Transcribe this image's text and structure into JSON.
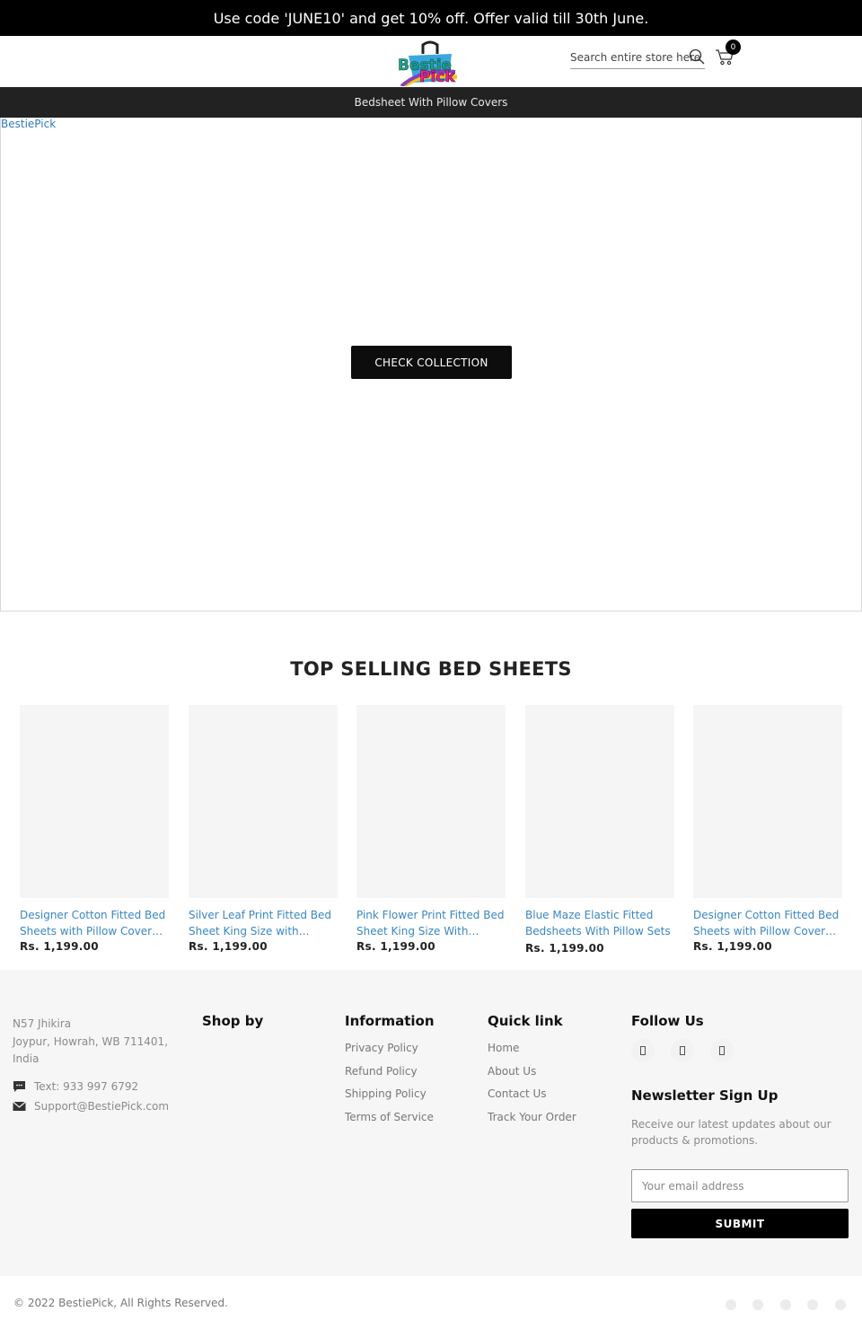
{
  "announcement": {
    "text": "Use code 'JUNE10' and get 10% off. Offer valid till 30th June."
  },
  "header": {
    "logo_alt": "BestiePick",
    "logo_text_top": "Bestie",
    "logo_text_bottom": "Pick",
    "search": {
      "placeholder": "Search entire store here",
      "value": ""
    },
    "cart_count": "0"
  },
  "nav": {
    "items": [
      {
        "label": "Bedsheet With Pillow Covers"
      }
    ]
  },
  "hero": {
    "image_alt": "BestiePick",
    "button_label": "CHECK COLLECTION"
  },
  "products_section": {
    "title": "TOP SELLING BED SHEETS",
    "items": [
      {
        "title": "Designer Cotton Fitted Bed Sheets with Pillow Cover…",
        "price": "Rs. 1,199.00"
      },
      {
        "title": "Silver Leaf Print Fitted Bed Sheet King Size with Pillow…",
        "price": "Rs. 1,199.00"
      },
      {
        "title": "Pink Flower Print Fitted Bed Sheet King Size With Pillow…",
        "price": "Rs. 1,199.00"
      },
      {
        "title": "Blue Maze Elastic Fitted Bedsheets With Pillow Sets",
        "price": "Rs. 1,199.00"
      },
      {
        "title": "Designer Cotton Fitted Bed Sheets with Pillow Cover…",
        "price": "Rs. 1,199.00"
      }
    ]
  },
  "footer": {
    "address": {
      "line1": "N57 Jhikira",
      "line2": "Joypur, Howrah, WB 711401,",
      "line3": "India"
    },
    "phone": "Text: 933 997 6792",
    "email": "Support@BestiePick.com",
    "shop_by": {
      "heading": "Shop by"
    },
    "information": {
      "heading": "Information",
      "links": [
        "Privacy Policy",
        "Refund Policy",
        "Shipping Policy",
        "Terms of Service"
      ]
    },
    "quick_link": {
      "heading": "Quick link",
      "links": [
        "Home",
        "About Us",
        "Contact Us",
        "Track Your Order"
      ]
    },
    "follow_us": {
      "heading": "Follow Us",
      "icons": [
        "social-icon-1",
        "social-icon-2",
        "social-icon-3"
      ]
    },
    "newsletter": {
      "heading": "Newsletter Sign Up",
      "text": "Receive our latest updates about our products & promotions.",
      "email_placeholder": "Your email address",
      "email_value": "",
      "submit_label": "SUBMIT"
    }
  },
  "bottom": {
    "copyright": "© 2022 BestiePick, All Rights Reserved.",
    "payment_icons": [
      "payment-icon-1",
      "payment-icon-2",
      "payment-icon-3",
      "payment-icon-4",
      "payment-icon-5"
    ]
  },
  "colors": {
    "announcement_bg": "#000000",
    "nav_bg": "#222222",
    "link_blue": "#3a87c0",
    "button_black": "#0d0d0d",
    "footer_bg": "#f6f6f6",
    "placeholder_bg": "#f5f5f5"
  }
}
